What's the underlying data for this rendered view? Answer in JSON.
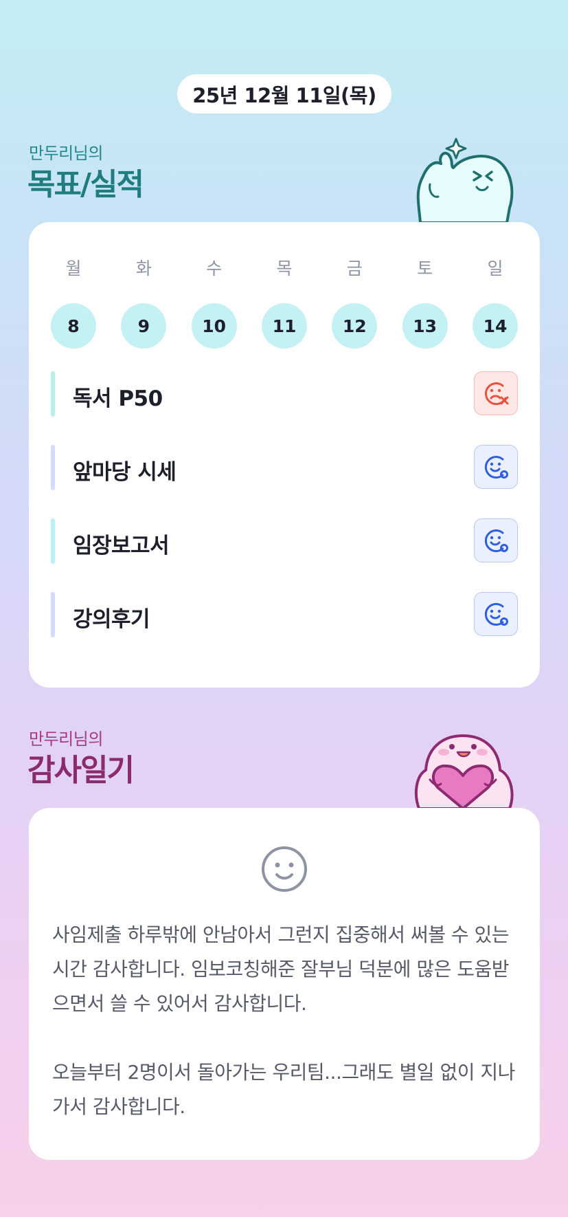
{
  "header": {
    "date": "25년 12월 11일(목)"
  },
  "goals_section": {
    "subtitle": "만두리님의",
    "title": "목표/실적",
    "week": [
      {
        "day": "월",
        "date": "8"
      },
      {
        "day": "화",
        "date": "9"
      },
      {
        "day": "수",
        "date": "10"
      },
      {
        "day": "목",
        "date": "11"
      },
      {
        "day": "금",
        "date": "12"
      },
      {
        "day": "토",
        "date": "13"
      },
      {
        "day": "일",
        "date": "14"
      }
    ],
    "goals": [
      {
        "label": "독서 P50",
        "status": "fail",
        "bar_color": "#b9f0e6"
      },
      {
        "label": "앞마당 시세",
        "status": "done",
        "bar_color": "#d3dcf8"
      },
      {
        "label": "임장보고서",
        "status": "done",
        "bar_color": "#bdf0f0"
      },
      {
        "label": "강의후기",
        "status": "done",
        "bar_color": "#d3dcf8"
      }
    ]
  },
  "thanks_section": {
    "subtitle": "만두리님의",
    "title": "감사일기",
    "paragraphs": [
      "사임제출 하루밖에 안남아서 그런지 집중해서 써볼 수 있는 시간 감사합니다. 임보코칭해준 잘부님 덕분에 많은 도움받으면서 쓸 수 있어서 감사합니다.",
      "오늘부터 2명이서 돌아가는 우리팀...그래도 별일 없이 지나가서 감사합니다."
    ]
  },
  "icons": {
    "fail": "sad-face-x-icon",
    "done": "smile-face-check-icon",
    "diary": "smile-face-icon"
  },
  "colors": {
    "goal_title": "#1f7d7f",
    "thanks_title": "#8b2a6c",
    "day_circle": "#c4f1f3",
    "fail": "#e8523f",
    "done": "#2f5fe0"
  }
}
